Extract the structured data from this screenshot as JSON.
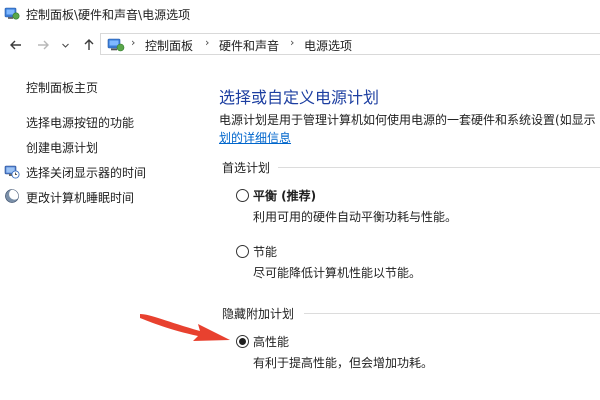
{
  "window": {
    "title": "控制面板\\硬件和声音\\电源选项"
  },
  "breadcrumb": {
    "items": [
      "控制面板",
      "硬件和声音",
      "电源选项"
    ]
  },
  "sidebar": {
    "home_label": "控制面板主页",
    "items": [
      {
        "label": "选择电源按钮的功能",
        "icon": null
      },
      {
        "label": "创建电源计划",
        "icon": null
      },
      {
        "label": "选择关闭显示器的时间",
        "icon": "monitor-clock-icon"
      },
      {
        "label": "更改计算机睡眠时间",
        "icon": "moon-icon"
      }
    ]
  },
  "main": {
    "title": "选择或自定义电源计划",
    "description": "电源计划是用于管理计算机如何使用电源的一套硬件和系统设置(如显示",
    "description_link": "划的详细信息",
    "groups": [
      {
        "label": "首选计划",
        "plans": [
          {
            "name": "平衡 (推荐)",
            "desc": "利用可用的硬件自动平衡功耗与性能。",
            "selected": false
          },
          {
            "name": "节能",
            "desc": "尽可能降低计算机性能以节能。",
            "selected": false
          }
        ]
      },
      {
        "label": "隐藏附加计划",
        "plans": [
          {
            "name": "高性能",
            "desc": "有利于提高性能，但会增加功耗。",
            "selected": true
          }
        ]
      }
    ]
  },
  "colors": {
    "title": "#1d3fa1",
    "link": "#0066cc",
    "arrow": "#e8412f"
  }
}
